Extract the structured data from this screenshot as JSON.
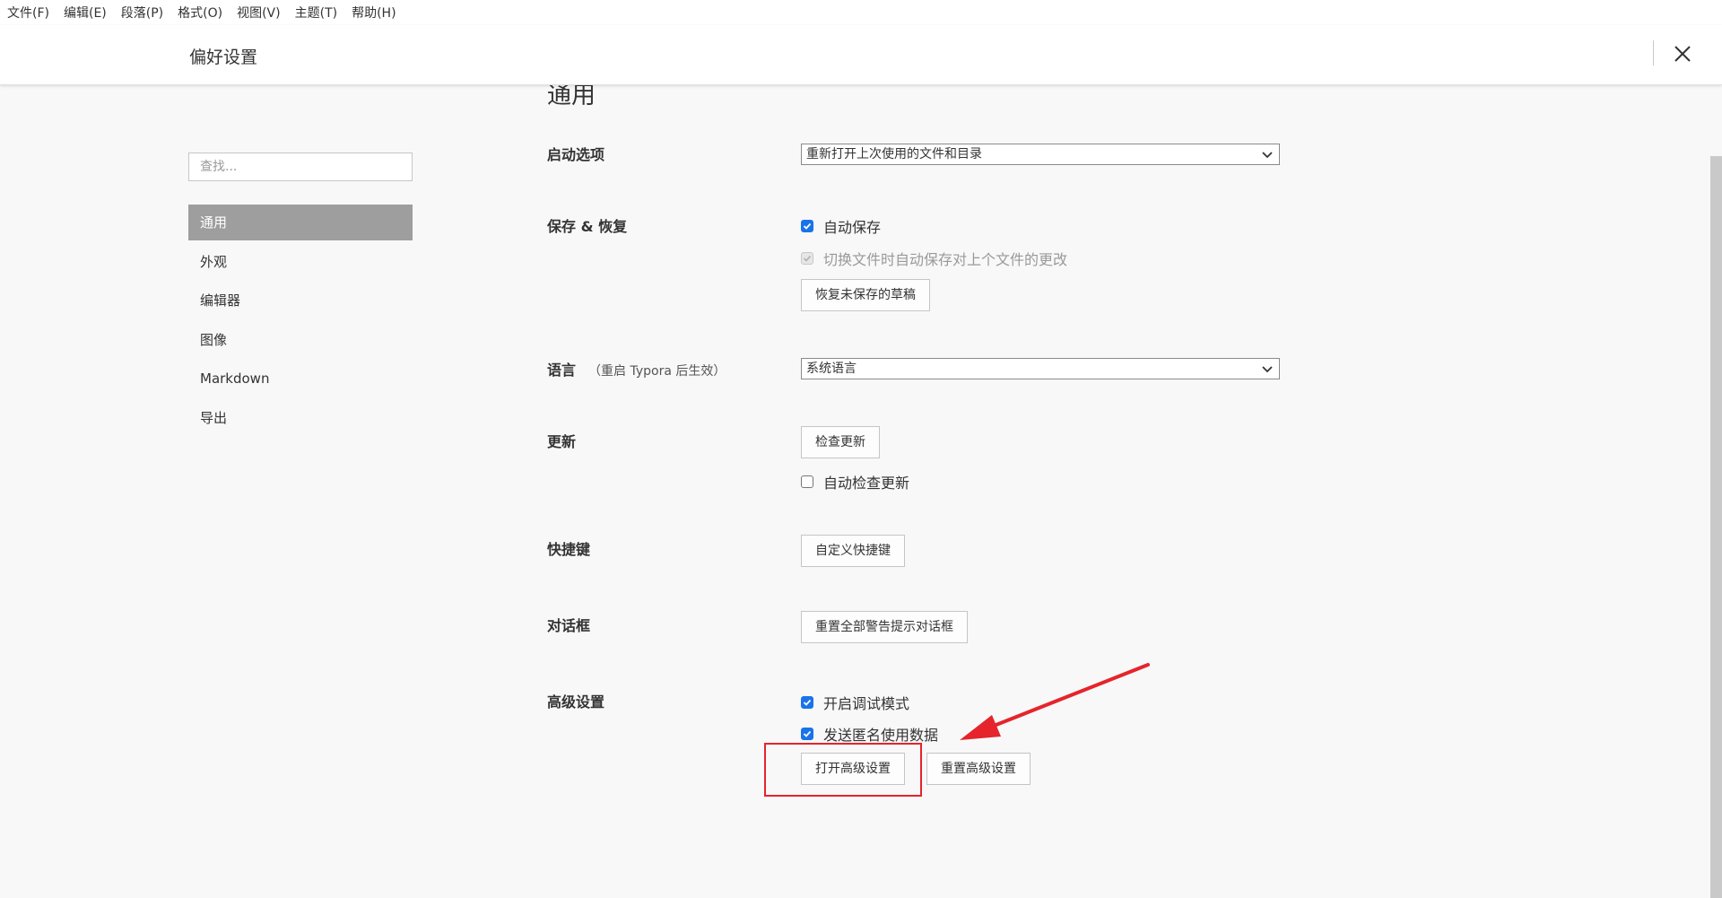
{
  "menubar": {
    "items": [
      "文件(F)",
      "编辑(E)",
      "段落(P)",
      "格式(O)",
      "视图(V)",
      "主题(T)",
      "帮助(H)"
    ]
  },
  "window": {
    "title": "偏好设置",
    "close_icon": "close-icon"
  },
  "sidebar": {
    "search_placeholder": "查找...",
    "items": [
      {
        "label": "通用",
        "active": true
      },
      {
        "label": "外观",
        "active": false
      },
      {
        "label": "编辑器",
        "active": false
      },
      {
        "label": "图像",
        "active": false
      },
      {
        "label": "Markdown",
        "active": false
      },
      {
        "label": "导出",
        "active": false
      }
    ]
  },
  "main": {
    "heading": "通用",
    "startup": {
      "label": "启动选项",
      "value": "重新打开上次使用的文件和目录"
    },
    "save": {
      "label": "保存 & 恢复",
      "autosave": {
        "label": "自动保存",
        "checked": true
      },
      "autosave_switch": {
        "label": "切换文件时自动保存对上个文件的更改",
        "checked": true,
        "disabled": true
      },
      "recover_button": "恢复未保存的草稿"
    },
    "language": {
      "label": "语言",
      "note": "（重启 Typora 后生效）",
      "value": "系统语言"
    },
    "update": {
      "label": "更新",
      "check_button": "检查更新",
      "auto_check": {
        "label": "自动检查更新",
        "checked": false
      }
    },
    "shortcuts": {
      "label": "快捷键",
      "button": "自定义快捷键"
    },
    "dialogs": {
      "label": "对话框",
      "button": "重置全部警告提示对话框"
    },
    "advanced": {
      "label": "高级设置",
      "debug": {
        "label": "开启调试模式",
        "checked": true
      },
      "telemetry": {
        "label": "发送匿名使用数据",
        "checked": true
      },
      "open_button": "打开高级设置",
      "reset_button": "重置高级设置"
    }
  },
  "annotation": {
    "color": "#e5242b"
  }
}
